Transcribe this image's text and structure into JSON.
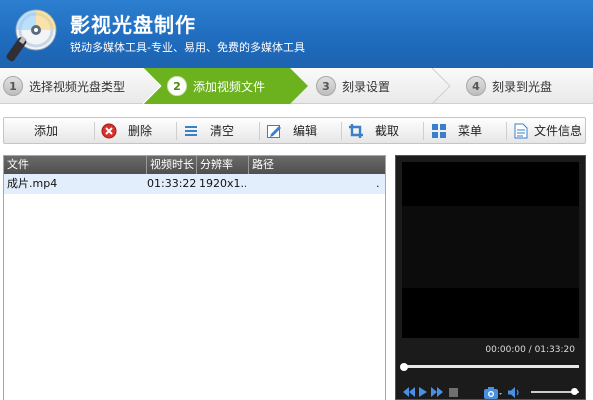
{
  "app": {
    "title": "影视光盘制作",
    "subtitle": "锐动多媒体工具-专业、易用、免费的多媒体工具"
  },
  "steps": [
    {
      "num": "1",
      "label": "选择视频光盘类型",
      "active": false
    },
    {
      "num": "2",
      "label": "添加视频文件",
      "active": true
    },
    {
      "num": "3",
      "label": "刻录设置",
      "active": false
    },
    {
      "num": "4",
      "label": "刻录到光盘",
      "active": false
    }
  ],
  "toolbar": {
    "add": "添加",
    "delete": "删除",
    "clear": "清空",
    "edit": "编辑",
    "crop": "截取",
    "menu": "菜单",
    "file_info": "文件信息"
  },
  "filelist": {
    "columns": [
      "文件",
      "视频时长",
      "分辨率",
      "路径"
    ],
    "rows": [
      {
        "file": "成片.mp4",
        "duration": "01:33:22",
        "resolution": "1920x1...",
        "path": "."
      }
    ]
  },
  "player": {
    "timecode": "00:00:00 / 01:33:20",
    "progress": 0,
    "volume": 1.0
  },
  "colors": {
    "header_blue": "#1f6bbd",
    "active_step_green": "#6bb21e",
    "selected_row": "#e3eefc"
  }
}
